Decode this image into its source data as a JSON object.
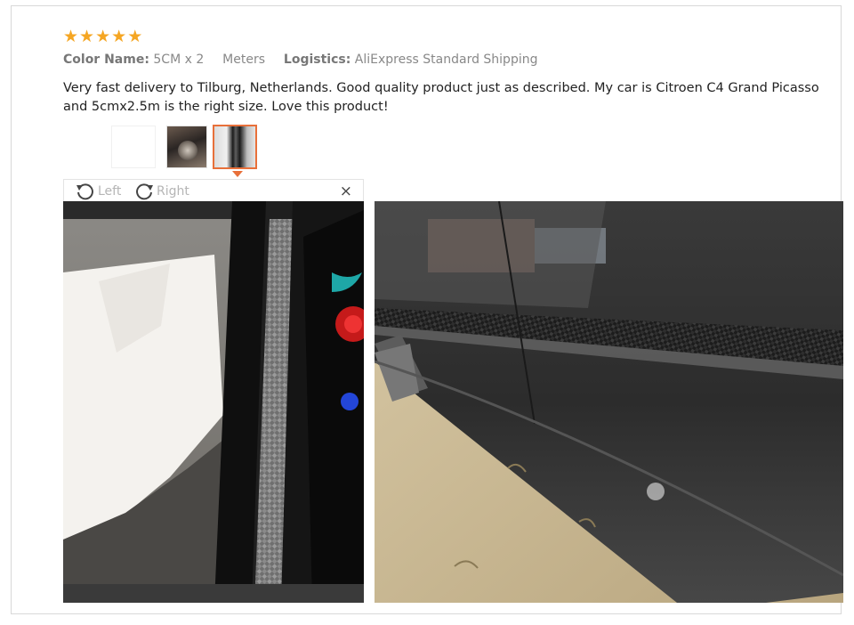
{
  "review": {
    "rating": 5,
    "stars": [
      "★",
      "★",
      "★",
      "★",
      "★"
    ],
    "color_name_label": "Color Name:",
    "color_name_value": "5CM x 2",
    "color_name_extra": "Meters",
    "logistics_label": "Logistics:",
    "logistics_value": "AliExpress Standard Shipping",
    "text": "Very fast delivery to Tilburg, Netherlands. Good quality product just as described. My car is Citroen C4 Grand Picasso and 5cmx2.5m is the right size. Love this product!"
  },
  "viewer": {
    "rotate_left_label": "Left",
    "rotate_right_label": "Right",
    "close_label": "×"
  },
  "colors": {
    "star": "#f5a623",
    "selected_thumb_border": "#e8703a",
    "card_border": "#d8d8d8"
  },
  "icons": {
    "rotate_left": "rotate-left-icon",
    "rotate_right": "rotate-right-icon",
    "close": "close-icon",
    "star": "star-icon"
  }
}
